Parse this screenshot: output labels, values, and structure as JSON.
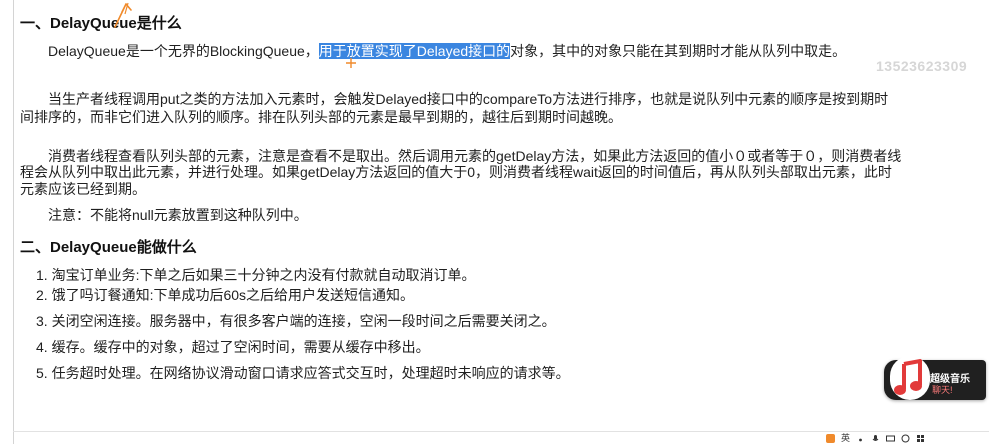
{
  "section1": {
    "heading": "一、DelayQueue是什么",
    "p1_before": "DelayQueue是一个无界的BlockingQueue，",
    "p1_highlight": "用于放置实现了Delayed接口的",
    "p1_after": "对象，其中的对象只能在其到期时才能从队列中取走。",
    "p2_line1": "当生产者线程调用put之类的方法加入元素时，会触发Delayed接口中的compareTo方法进行排序，也就是说队列中元素的顺序是按到期时",
    "p2_line2": "间排序的，而非它们进入队列的顺序。排在队列头部的元素是最早到期的，越往后到期时间越晚。",
    "p3_line1": "消费者线程查看队列头部的元素，注意是查看不是取出。然后调用元素的getDelay方法，如果此方法返回的值小０或者等于０，则消费者线",
    "p3_line2": "程会从队列中取出此元素，并进行处理。如果getDelay方法返回的值大于0，则消费者线程wait返回的时间值后，再从队列头部取出元素，此时",
    "p3_line3": "元素应该已经到期。",
    "p4": "注意：不能将null元素放置到这种队列中。"
  },
  "section2": {
    "heading": "二、DelayQueue能做什么",
    "items": [
      "1. 淘宝订单业务:下单之后如果三十分钟之内没有付款就自动取消订单。",
      "2. 饿了吗订餐通知:下单成功后60s之后给用户发送短信通知。",
      "3. 关闭空闲连接。服务器中，有很多客户端的连接，空闲一段时间之后需要关闭之。",
      "4. 缓存。缓存中的对象，超过了空闲时间，需要从缓存中移出。",
      "5. 任务超时处理。在网络协议滑动窗口请求应答式交互时，处理超时未响应的请求等。"
    ]
  },
  "watermark": "13523623309",
  "badge": {
    "title": "超级音乐",
    "subtitle": "聊天!"
  },
  "taskbar": {
    "lang": "英"
  },
  "colors": {
    "highlight": "#3b86e0",
    "cursor": "#f08a2b"
  }
}
